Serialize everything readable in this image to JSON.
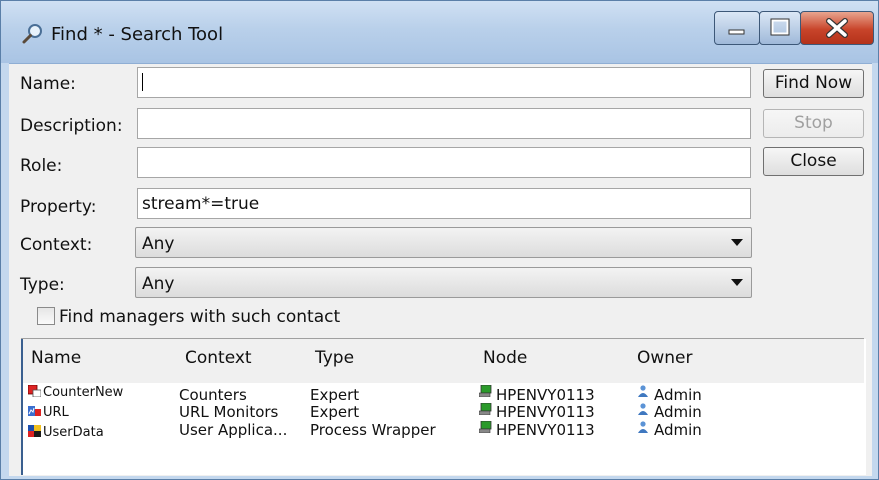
{
  "window": {
    "title": "Find * - Search Tool"
  },
  "form": {
    "name_label": "Name:",
    "name_value": "",
    "description_label": "Description:",
    "description_value": "",
    "role_label": "Role:",
    "role_value": "",
    "property_label": "Property:",
    "property_value": "stream*=true",
    "context_label": "Context:",
    "context_value": "Any",
    "type_label": "Type:",
    "type_value": "Any",
    "checkbox_label": "Find managers with such contact",
    "checkbox_checked": false
  },
  "buttons": {
    "find_now": "Find Now",
    "stop": "Stop",
    "close": "Close"
  },
  "results": {
    "columns": [
      "Name",
      "Context",
      "Type",
      "Node",
      "Owner"
    ],
    "rows": [
      {
        "name": "CounterNew",
        "context": "Counters",
        "type": "Expert",
        "node": "HPENVY0113",
        "owner": "Admin"
      },
      {
        "name": "URL",
        "context": "URL Monitors",
        "type": "Expert",
        "node": "HPENVY0113",
        "owner": "Admin"
      },
      {
        "name": "UserData",
        "context": "User Applica...",
        "type": "Process Wrapper",
        "node": "HPENVY0113",
        "owner": "Admin"
      }
    ]
  },
  "icons": {
    "title": "magnifier-icon",
    "row_0": "counter-icon",
    "row_1": "url-icon",
    "row_2": "userdata-icon",
    "node": "computer-icon",
    "owner": "user-icon"
  }
}
